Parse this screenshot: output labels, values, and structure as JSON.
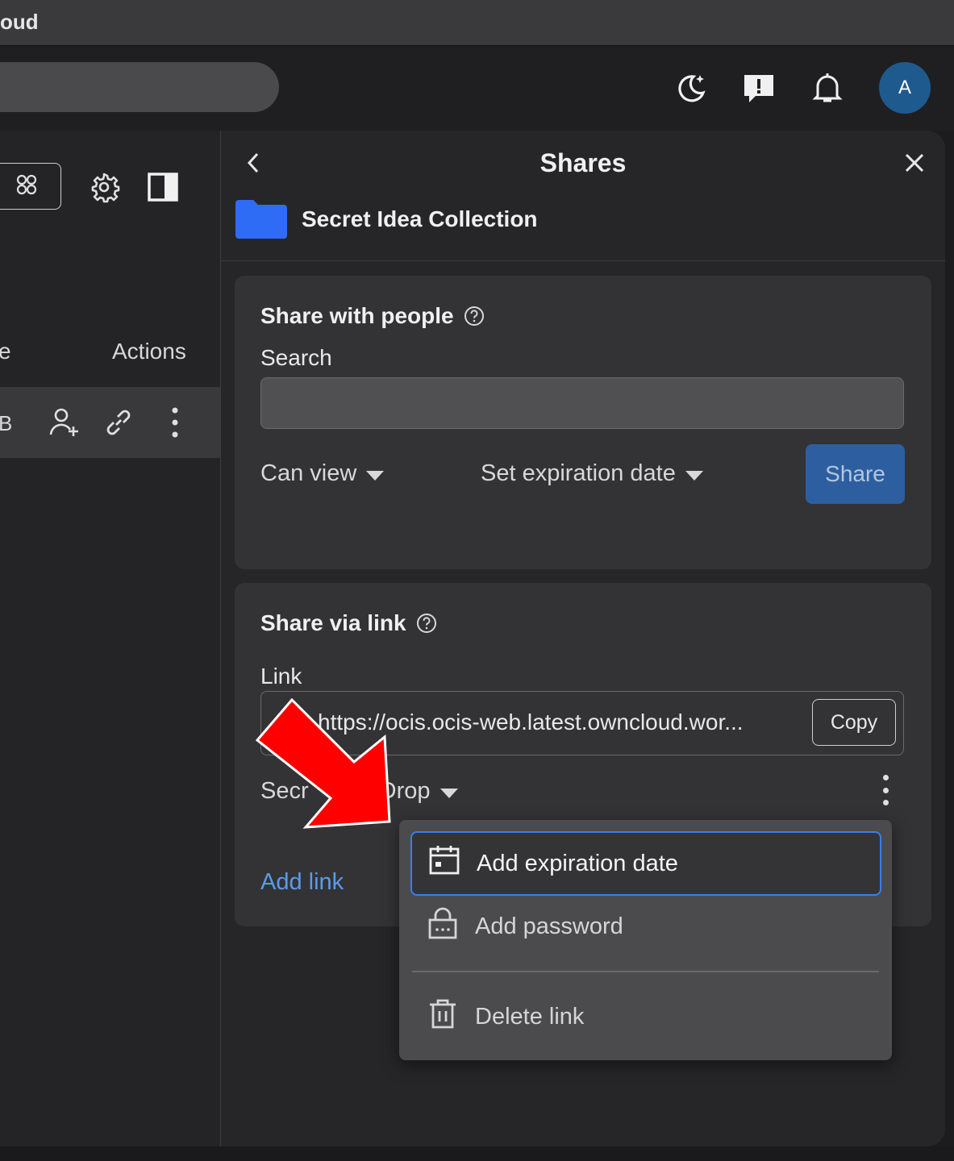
{
  "window": {
    "title": "oud"
  },
  "topbar": {
    "theme_icon": "moon-sparkle-icon",
    "feedback_icon": "feedback-exclamation-icon",
    "notifications_icon": "bell-icon",
    "avatar_initial": "A"
  },
  "files": {
    "columns": {
      "partial": "e",
      "actions": "Actions"
    },
    "row": {
      "size_partial": "B"
    }
  },
  "panel": {
    "title": "Shares",
    "resource_name": "Secret Idea Collection",
    "share_with_people": {
      "heading": "Share with people",
      "search_label": "Search",
      "search_value": "",
      "role_dropdown": "Can view",
      "expiration_dropdown": "Set expiration date",
      "share_button": "Share"
    },
    "share_via_link": {
      "heading": "Share via link",
      "link_label": "Link",
      "link_url": "https://ocis.ocis-web.latest.owncloud.wor...",
      "copy_button": "Copy",
      "link_type_left": "Secr",
      "link_type_right": "Drop",
      "add_link": "Add link"
    }
  },
  "context_menu": {
    "items": [
      {
        "label": "Add expiration date",
        "icon": "calendar-icon"
      },
      {
        "label": "Add password",
        "icon": "lock-icon"
      },
      {
        "label": "Delete link",
        "icon": "trash-icon"
      }
    ]
  },
  "annotation": {
    "arrow_color": "#ff0000"
  }
}
